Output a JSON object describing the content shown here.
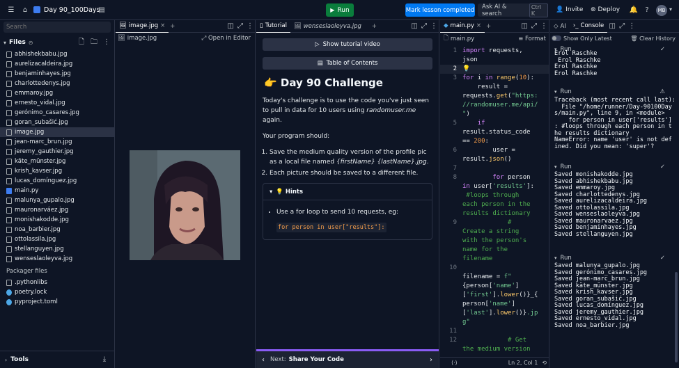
{
  "topbar": {
    "repl_name": "Day 90_100Days",
    "run_label": "Run",
    "mark_label": "Mark lesson completed",
    "ai_search_label": "Ask AI & search",
    "ai_search_kbd": "Ctrl K",
    "invite_label": "Invite",
    "deploy_label": "Deploy",
    "avatar_initials": "MB"
  },
  "sidebar": {
    "search_placeholder": "Search",
    "files_label": "Files",
    "files": [
      "abhishekbabu.jpg",
      "aurelizacaldeira.jpg",
      "benjaminhayes.jpg",
      "charlottedenys.jpg",
      "emmaroy.jpg",
      "ernesto_vidal.jpg",
      "gerónimo_casares.jpg",
      "goran_subašić.jpg",
      "image.jpg",
      "jean-marc_brun.jpg",
      "jeremy_gauthier.jpg",
      "käte_münster.jpg",
      "krish_kavser.jpg",
      "lucas_domínguez.jpg",
      "main.py",
      "malunya_gupalo.jpg",
      "mauronarváez.jpg",
      "monishakodde.jpg",
      "noa_barbier.jpg",
      "ottolassila.jpg",
      "stellanguyen.jpg",
      "wenseslaoleyva.jpg"
    ],
    "packager_label": "Packager files",
    "packager_files": [
      ".pythonlibs",
      "poetry.lock",
      "pyproject.toml"
    ],
    "tools_label": "Tools"
  },
  "image_pane": {
    "tab_label": "image.jpg",
    "filename": "image.jpg",
    "open_editor_label": "Open in Editor"
  },
  "tutorial": {
    "tab_label": "Tutorial",
    "tab2_label": "wenseslaoleyva.jpg",
    "video_btn": "Show tutorial video",
    "toc_btn": "Table of Contents",
    "title": "👉 Day 90 Challenge",
    "intro_1": "Today's challenge is to use the code you've just seen to pull in data for 10 users using ",
    "intro_site": "randomuser.me",
    "intro_2": " again.",
    "should": "Your program should:",
    "item1_a": "Save the medium quality version of the profile pic as a local file named ",
    "item1_b": "{firstName} {lastName}.jpg",
    "item1_c": ".",
    "item2": "Each picture should be saved to a different file.",
    "hints_label": "💡 Hints",
    "hint_text": "Use a for loop to send 10 requests, eg:",
    "hint_code": "for person in user[\"results\"]:",
    "next_label": "Next:",
    "next_title": "Share Your Code"
  },
  "editor": {
    "tab_label": "main.py",
    "file_label": "main.py",
    "format_label": "Format",
    "status": "Ln 2, Col 1"
  },
  "console": {
    "ai_tab": "AI",
    "console_tab": "Console",
    "show_latest": "Show Only Latest",
    "clear_label": "Clear History",
    "run_label": "Run",
    "block0": [
      "Erol Raschke",
      " Erol Raschke",
      "Erol Raschke",
      "Erol Raschke"
    ],
    "block1": [
      "Traceback (most recent call last):",
      "  File \"/home/runner/Day-90100Day",
      "s/main.py\", line 9, in <module>",
      "    for person in user['results']",
      ": #loops through each person in t",
      "he results dictionary",
      "NameError: name 'user' is not def",
      "ined. Did you mean: 'super'?"
    ],
    "block2": [
      "Saved monishakodde.jpg",
      "Saved abhishekbabu.jpg",
      "Saved emmaroy.jpg",
      "Saved charlottedenys.jpg",
      "Saved aurelizacaldeira.jpg",
      "Saved ottolassila.jpg",
      "Saved wenseslaoleyva.jpg",
      "Saved mauronarvaez.jpg",
      "Saved benjaminhayes.jpg",
      "Saved stellanguyen.jpg"
    ],
    "block3": [
      "Saved malunya_gupalo.jpg",
      "Saved gerónimo_casares.jpg",
      "Saved jean-marc_brun.jpg",
      "Saved käte_münster.jpg",
      "Saved krish_kavser.jpg",
      "Saved goran_subašić.jpg",
      "Saved lucas_domínguez.jpg",
      "Saved jeremy_gauthier.jpg",
      "Saved ernesto_vidal.jpg",
      "Saved noa_barbier.jpg"
    ]
  }
}
